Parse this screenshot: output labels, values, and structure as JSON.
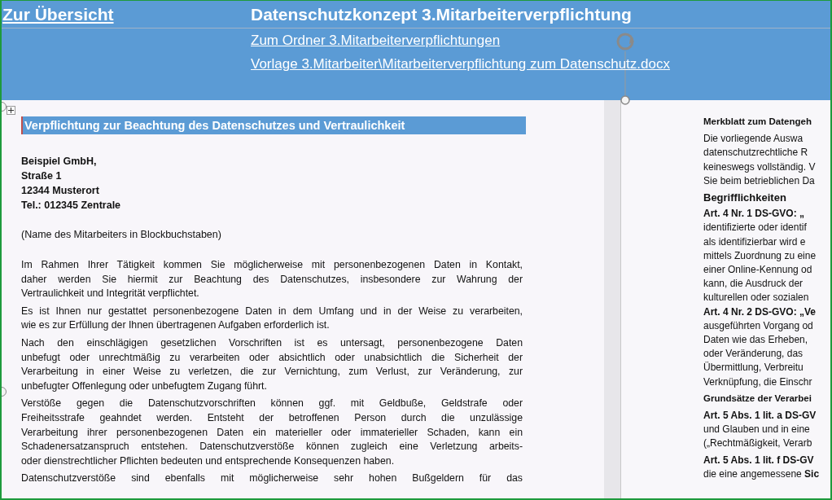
{
  "header": {
    "back_link": "Zur Übersicht",
    "title": "Datenschutzkonzept 3.Mitarbeiterverpflichtung",
    "links": [
      "Zum Ordner 3.Mitarbeiterverpflichtungen",
      "Vorlage 3.Mitarbeiter\\Mitarbeiterverpflichtung zum Datenschutz.docx"
    ]
  },
  "left_page": {
    "heading": "Verpflichtung zur Beachtung des Datenschutzes und Vertraulichkeit",
    "address": [
      "Beispiel GmbH,",
      "Straße 1",
      "12344 Musterort",
      "Tel.: 012345 Zentrale"
    ],
    "name_hint": "(Name des Mitarbeiters in Blockbuchstaben)",
    "paragraphs": [
      {
        "lines": [
          "Im Rahmen Ihrer Tätigkeit kommen Sie möglicherweise mit personenbezogenen Daten in Kontakt,",
          "daher werden Sie hiermit zur Beachtung des Datenschutzes, insbesondere zur Wahrung der",
          "Vertraulichkeit und Integrität verpflichtet."
        ]
      },
      {
        "lines": [
          "Es ist Ihnen nur gestattet personenbezogene Daten in dem Umfang und in der Weise zu verarbeiten,",
          "wie es zur Erfüllung der Ihnen übertragenen Aufgaben erforderlich ist."
        ]
      },
      {
        "lines": [
          "Nach den einschlägigen gesetzlichen Vorschriften ist es untersagt, personenbezogene Daten",
          "unbefugt oder unrechtmäßig zu verarbeiten oder absichtlich oder unabsichtlich die Sicherheit der",
          "Verarbeitung in einer Weise zu verletzen, die zur Vernichtung, zum Verlust, zur Veränderung, zur",
          "unbefugter Offenlegung oder unbefugtem Zugang führt."
        ]
      },
      {
        "lines": [
          "Verstöße gegen die Datenschutzvorschriften können ggf. mit Geldbuße, Geldstrafe oder",
          "Freiheitsstrafe geahndet werden. Entsteht der betroffenen Person durch die unzulässige",
          "Verarbeitung ihrer personenbezogenen Daten ein materieller oder immaterieller Schaden, kann ein",
          "Schadenersatzanspruch entstehen. Datenschutzverstöße können zugleich eine Verletzung arbeits-",
          "oder dienstrechtlicher Pflichten bedeuten und entsprechende Konsequenzen haben."
        ]
      },
      {
        "lines": [
          "Datenschutzverstöße sind ebenfalls mit möglicherweise sehr hohen Bußgeldern für das"
        ],
        "truncated": true
      }
    ]
  },
  "right_page": {
    "blocks": [
      {
        "kind": "title",
        "lines": [
          "Merkblatt zum Datengeh"
        ]
      },
      {
        "kind": "text",
        "lines": [
          "Die vorliegende Auswa",
          "datenschutzrechtliche R",
          "keineswegs vollständig. V",
          "Sie beim betrieblichen Da"
        ]
      },
      {
        "kind": "section",
        "lines": [
          "Begrifflichkeiten"
        ]
      },
      {
        "kind": "text",
        "lines": [
          "**Art. 4 Nr. 1 DS-GVO: „**",
          "identifizierte oder identif",
          "als identifizierbar wird e",
          "mittels Zuordnung zu eine",
          "einer Online-Kennung od",
          "kann, die Ausdruck der",
          "kulturellen oder sozialen",
          "**Art. 4 Nr. 2 DS-GVO: „Ve**",
          "ausgeführten Vorgang od",
          "Daten wie das Erheben,",
          "oder Veränderung, das",
          "Übermittlung, Verbreitu",
          "Verknüpfung, die Einschr"
        ]
      },
      {
        "kind": "title",
        "lines": [
          "Grundsätze der Verarbei"
        ]
      },
      {
        "kind": "text",
        "lines": [
          "**Art. 5 Abs. 1 lit. a DS-GV**",
          "und Glauben und in eine",
          "(„Rechtmäßigkeit, Verarb"
        ]
      },
      {
        "kind": "text",
        "lines": [
          "**Art. 5 Abs. 1 lit. f DS-GV**",
          "die eine angemessene **Sic**"
        ]
      }
    ]
  }
}
